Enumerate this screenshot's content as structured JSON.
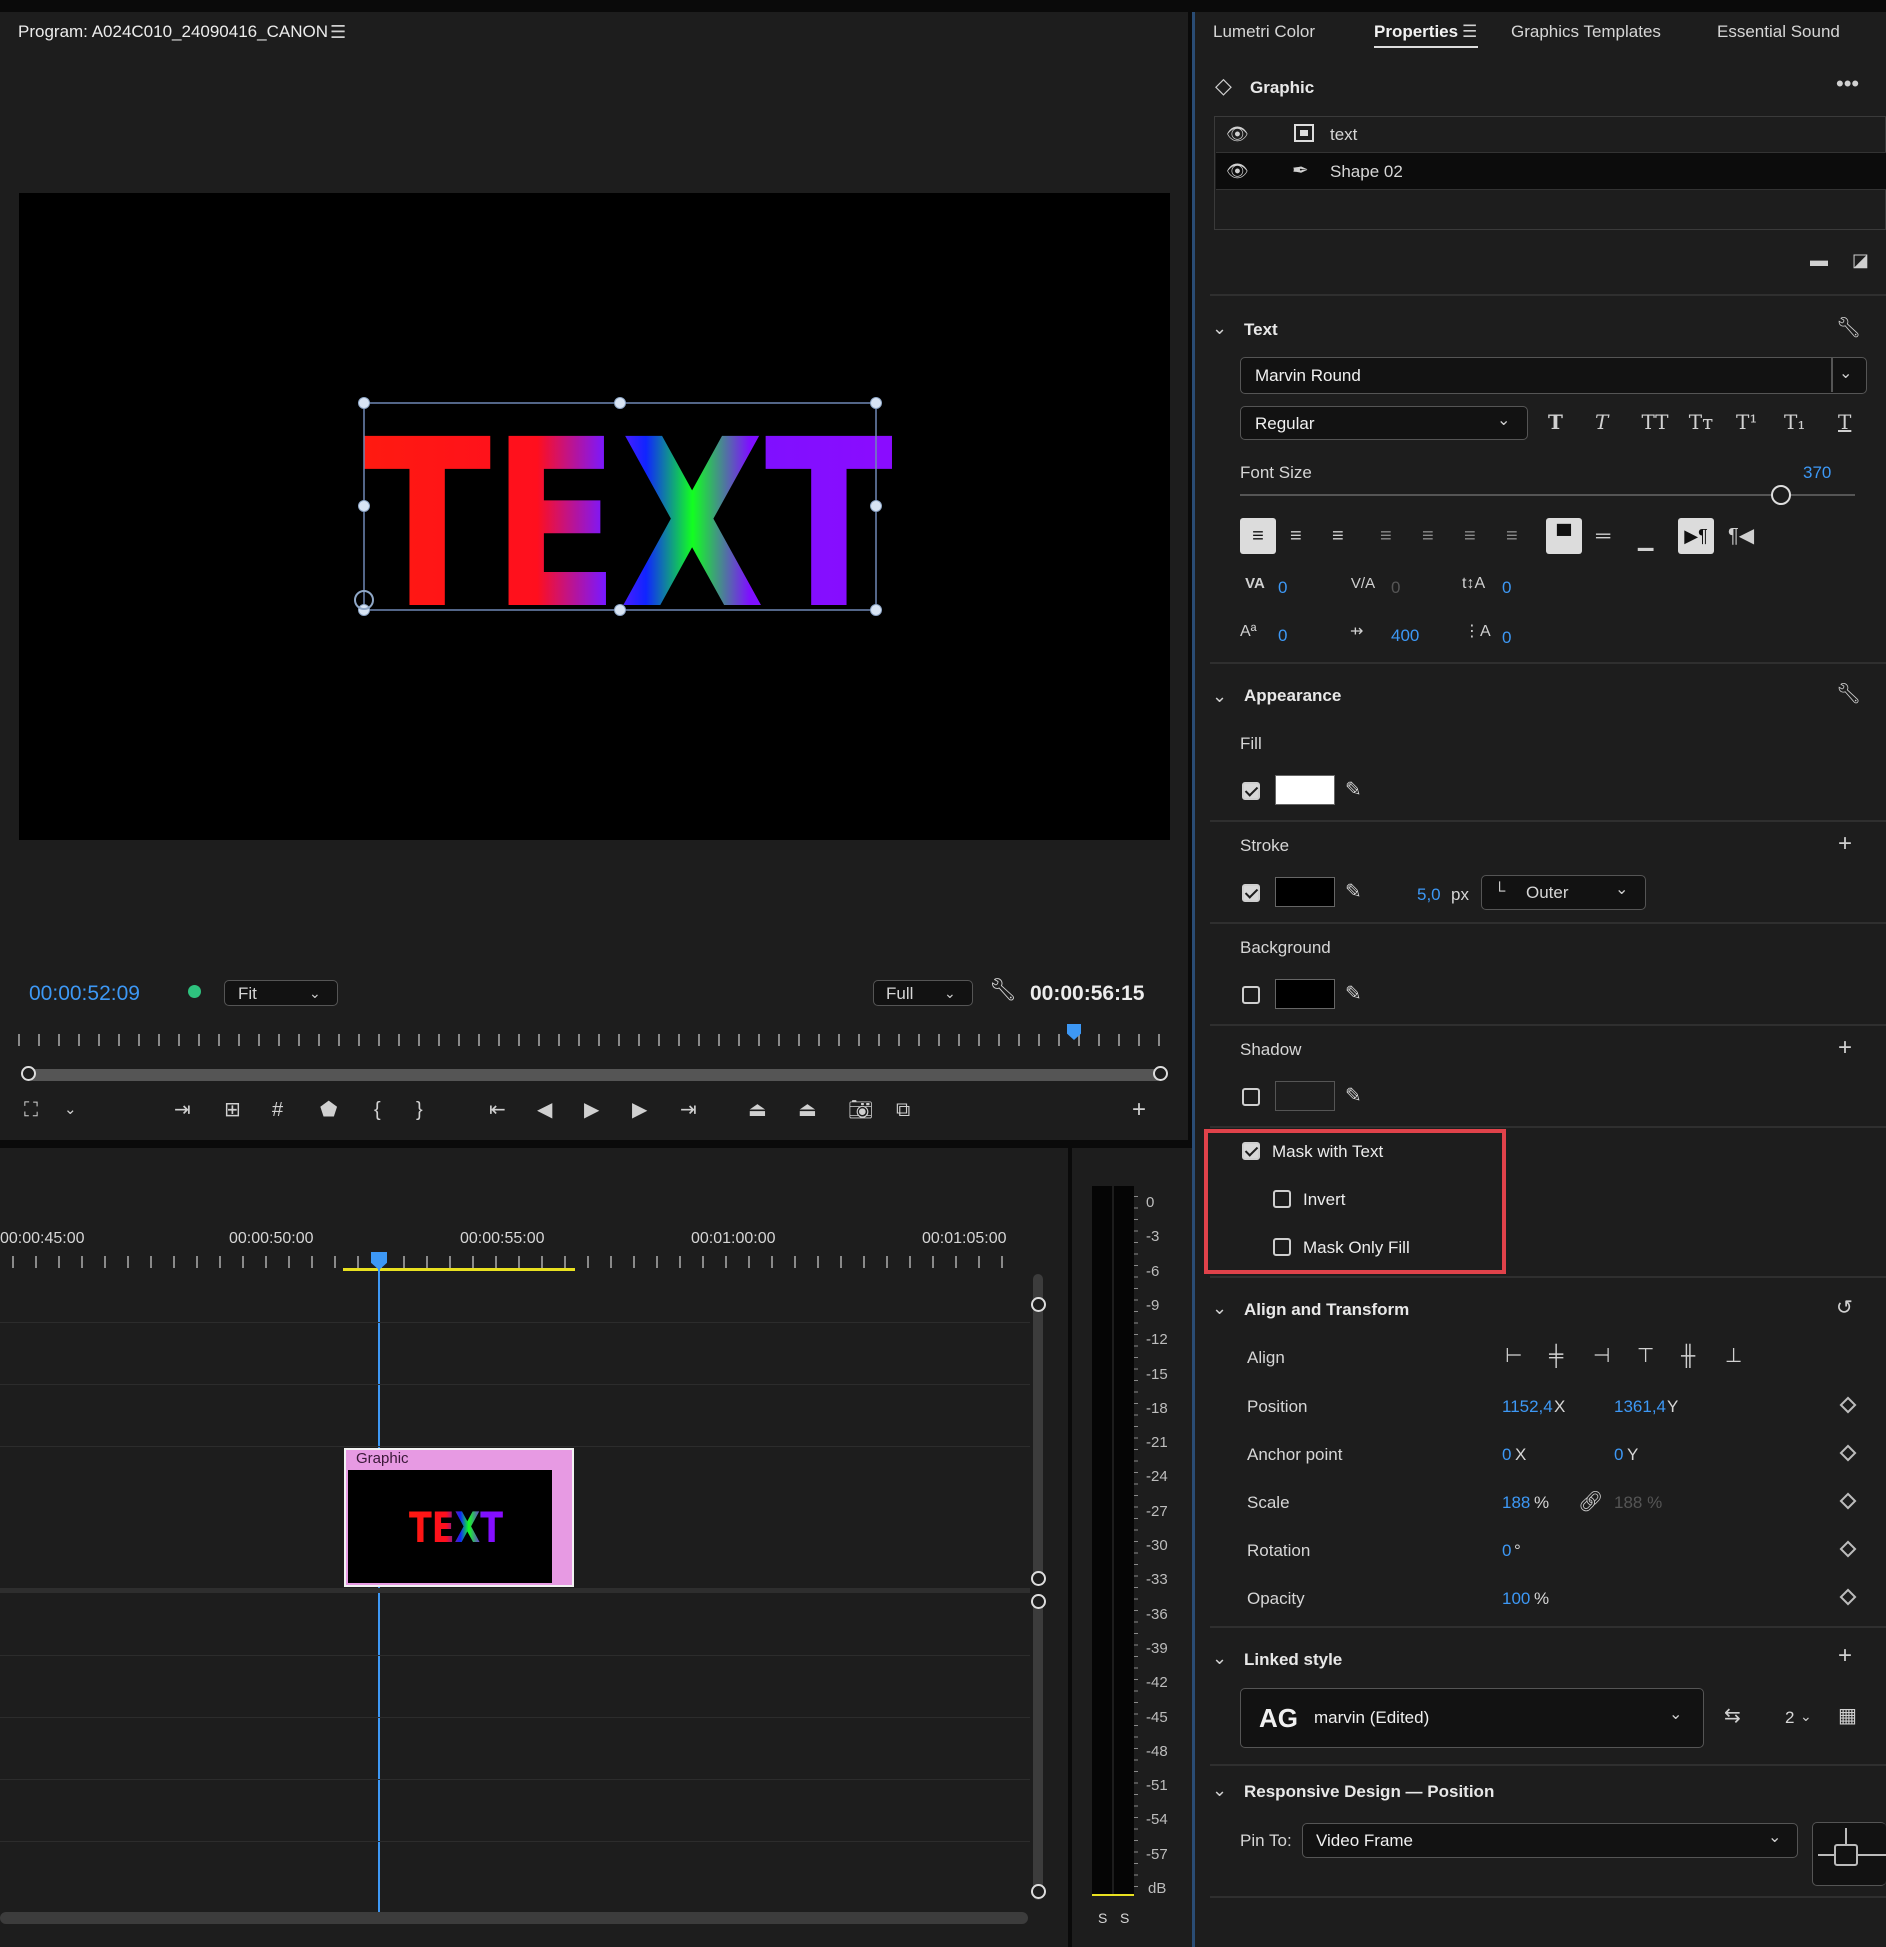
{
  "program": {
    "title": "Program: A024C010_24090416_CANON",
    "timecode_left": "00:00:52:09",
    "fit_label": "Fit",
    "quality_label": "Full",
    "timecode_right": "00:00:56:15",
    "preview_text": "TEXT"
  },
  "timeline": {
    "ruler": [
      "00:00:45:00",
      "00:00:50:00",
      "00:00:55:00",
      "00:01:00:00",
      "00:01:05:00"
    ],
    "clip_label": "Graphic",
    "clip_thumb_text": "TEXT",
    "meter_ticks": [
      "0",
      "-3",
      "-6",
      "-9",
      "-12",
      "-15",
      "-18",
      "-21",
      "-24",
      "-27",
      "-30",
      "-33",
      "-36",
      "-39",
      "-42",
      "-45",
      "-48",
      "-51",
      "-54",
      "-57",
      "dB"
    ],
    "meter_solo": [
      "S",
      "S"
    ]
  },
  "tabs": [
    "Lumetri Color",
    "Properties",
    "Graphics Templates",
    "Essential Sound"
  ],
  "graphic": {
    "title": "Graphic",
    "layers": [
      "text",
      "Shape 02"
    ]
  },
  "text_section": {
    "title": "Text",
    "font": "Marvin Round",
    "style": "Regular",
    "font_size_label": "Font Size",
    "font_size": "370",
    "font_size_fraction": 0.88,
    "kerning": "0",
    "tracking": "0",
    "baseline": "0",
    "leading": "0",
    "tsume": "400",
    "tab_width": "0"
  },
  "appearance": {
    "title": "Appearance",
    "fill_label": "Fill",
    "stroke_label": "Stroke",
    "stroke_width": "5,0",
    "stroke_unit": "px",
    "stroke_type": "Outer",
    "background_label": "Background",
    "shadow_label": "Shadow",
    "colors": {
      "fill": "#ffffff",
      "stroke": "#000000",
      "background": "#000000",
      "shadow": "#1e1e1e"
    }
  },
  "mask": {
    "mask_with_text": "Mask with Text",
    "invert": "Invert",
    "mask_only_fill": "Mask Only Fill",
    "highlight_color": "#e0424a"
  },
  "align_transform": {
    "title": "Align and Transform",
    "align_label": "Align",
    "position_label": "Position",
    "position_x": "1152,4",
    "position_y": "1361,4",
    "anchor_label": "Anchor point",
    "anchor_x": "0",
    "anchor_y": "0",
    "scale_label": "Scale",
    "scale": "188",
    "scale_locked": "188 %",
    "rotation_label": "Rotation",
    "rotation": "0",
    "opacity_label": "Opacity",
    "opacity": "100",
    "x_suffix": "X",
    "y_suffix": "Y",
    "pct": "%",
    "deg": "°"
  },
  "linked_style": {
    "title": "Linked style",
    "badge": "AG",
    "name": "marvin (Edited)",
    "count": "2"
  },
  "responsive": {
    "title": "Responsive Design — Position",
    "pin_label": "Pin To:",
    "pin_value": "Video Frame"
  }
}
